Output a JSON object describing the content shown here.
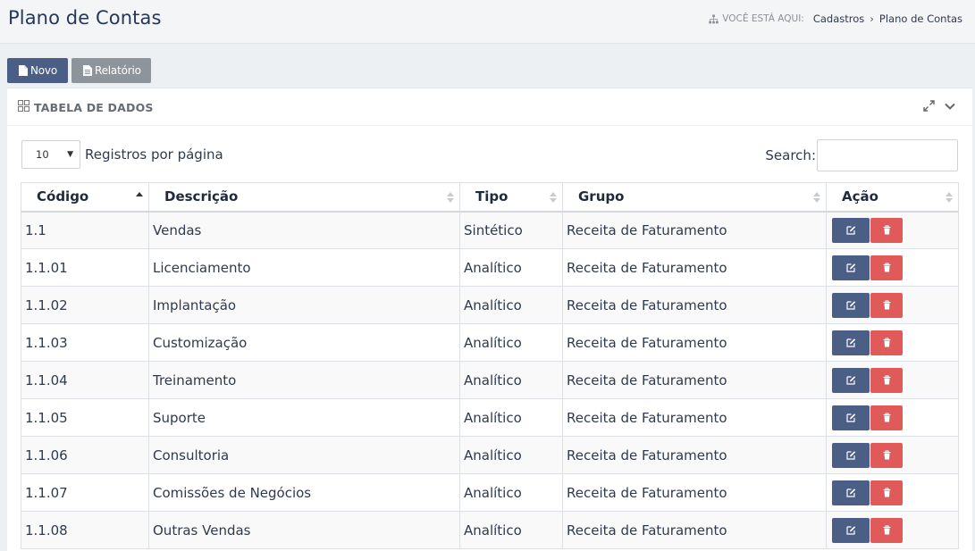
{
  "header": {
    "title": "Plano de Contas",
    "breadcrumb_lead": "VOCÊ ESTÁ AQUI:",
    "breadcrumb": [
      "Cadastros",
      "Plano de Contas"
    ]
  },
  "toolbar": {
    "new_label": "Novo",
    "report_label": "Relatório"
  },
  "panel": {
    "title": "TABELA DE DADOS"
  },
  "table_controls": {
    "page_length": "10",
    "page_length_label": "Registros por página",
    "search_label": "Search:",
    "search_value": ""
  },
  "table": {
    "columns": [
      "Código",
      "Descrição",
      "Tipo",
      "Grupo",
      "Ação"
    ],
    "rows": [
      {
        "codigo": "1.1",
        "descricao": "Vendas",
        "tipo": "Sintético",
        "grupo": "Receita de Faturamento"
      },
      {
        "codigo": "1.1.01",
        "descricao": "Licenciamento",
        "tipo": "Analítico",
        "grupo": "Receita de Faturamento"
      },
      {
        "codigo": "1.1.02",
        "descricao": "Implantação",
        "tipo": "Analítico",
        "grupo": "Receita de Faturamento"
      },
      {
        "codigo": "1.1.03",
        "descricao": "Customização",
        "tipo": "Analítico",
        "grupo": "Receita de Faturamento"
      },
      {
        "codigo": "1.1.04",
        "descricao": "Treinamento",
        "tipo": "Analítico",
        "grupo": "Receita de Faturamento"
      },
      {
        "codigo": "1.1.05",
        "descricao": "Suporte",
        "tipo": "Analítico",
        "grupo": "Receita de Faturamento"
      },
      {
        "codigo": "1.1.06",
        "descricao": "Consultoria",
        "tipo": "Analítico",
        "grupo": "Receita de Faturamento"
      },
      {
        "codigo": "1.1.07",
        "descricao": "Comissões de Negócios",
        "tipo": "Analítico",
        "grupo": "Receita de Faturamento"
      },
      {
        "codigo": "1.1.08",
        "descricao": "Outras Vendas",
        "tipo": "Analítico",
        "grupo": "Receita de Faturamento"
      }
    ]
  },
  "icons": {
    "breadcrumb": "sitemap-icon",
    "new": "file-icon",
    "report": "file-text-icon",
    "panel": "grid-icon",
    "expand": "expand-icon",
    "collapse": "chevron-down-icon",
    "edit": "edit-icon",
    "delete": "trash-icon"
  },
  "colors": {
    "primary": "#4b5e85",
    "secondary": "#8e949b",
    "danger": "#e05a5a",
    "title": "#26385a"
  }
}
